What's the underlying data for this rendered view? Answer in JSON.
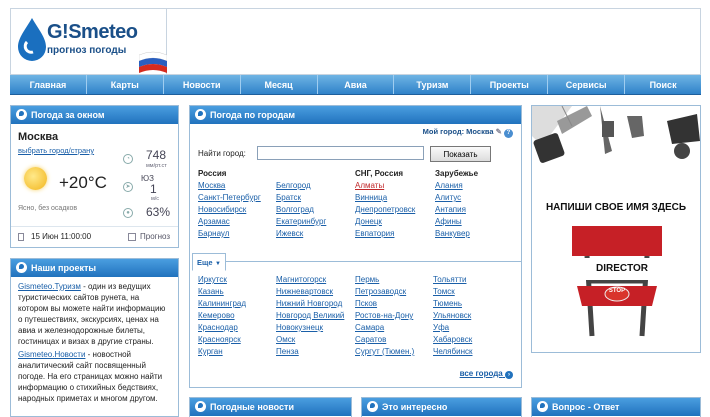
{
  "logo": {
    "brand": "G!Smeteo",
    "sub": "прогноз погоды"
  },
  "nav": [
    "Главная",
    "Карты",
    "Новости",
    "Месяц",
    "Авиа",
    "Туризм",
    "Проекты",
    "Сервисы",
    "Поиск"
  ],
  "weather": {
    "title": "Погода за окном",
    "city": "Москва",
    "change": "выбрать город/страну",
    "temp": "+20°C",
    "desc": "Ясно, без осадков",
    "pressure": "748",
    "pressure_unit": "мм/рт.ст",
    "wind_dir": "ЮЗ",
    "wind": "1",
    "wind_unit": "м/с",
    "humidity": "63%",
    "date": "15 Июн 11:00:00",
    "forecast": "Прогноз"
  },
  "projects": {
    "title": "Наши проекты",
    "p1_link": "Gismeteo.Туризм",
    "p1_text": " - один из ведущих туристических сайтов рунета, на котором вы можете найти информацию о путешествиях, экскурсиях, ценах на авиа и железнодорожные билеты, гостиницах и визах в другие страны.",
    "p2_link": "Gismeteo.Новости",
    "p2_text": " - новостной аналитический сайт посвященный погоде. На его страницах можно найти информацию о стихийных бедствиях, народных приметах и многом другом."
  },
  "cities": {
    "title": "Погода по городам",
    "my_city": "Мой город: Москва",
    "find_label": "Найти город:",
    "find_placeholder": "",
    "find_button": "Показать",
    "col_russia": "Россия",
    "col_cis": "СНГ, Россия",
    "col_abroad": "Зарубежье",
    "russia1": [
      "Москва",
      "Санкт-Петербург",
      "Новосибирск",
      "Арзамас",
      "Барнаул"
    ],
    "russia2": [
      "Белгород",
      "Братск",
      "Волгоград",
      "Екатеринбург",
      "Ижевск"
    ],
    "cis": [
      "Алматы",
      "Винница",
      "Днепропетровск",
      "Донецк",
      "Евпатория"
    ],
    "abroad": [
      "Алания",
      "Алитус",
      "Антапия",
      "Афины",
      "Ванкувер"
    ],
    "more": "Еще",
    "list1": [
      "Иркутск",
      "Казань",
      "Калининград",
      "Кемерово",
      "Краснодар",
      "Красноярск",
      "Курган"
    ],
    "list2": [
      "Магнитогорск",
      "Нижневартовск",
      "Нижний Новгород",
      "Новгород Великий",
      "Новокузнецк",
      "Омск",
      "Пенза"
    ],
    "list3": [
      "Пермь",
      "Петрозаводск",
      "Псков",
      "Ростов-на-Дону",
      "Самара",
      "Саратов",
      "Сургут (Тюмен.)"
    ],
    "list4": [
      "Тольятти",
      "Томск",
      "Тюмень",
      "Ульяновск",
      "Уфа",
      "Хабаровск",
      "Челябинск"
    ],
    "all": "все города"
  },
  "ad": {
    "headline": "НАПИШИ СВОЕ ИМЯ ЗДЕСЬ",
    "director": "DIRECTOR",
    "stop": "STOP"
  },
  "bottom": [
    "Погодные новости",
    "Это интересно",
    "Вопрос - Ответ"
  ]
}
